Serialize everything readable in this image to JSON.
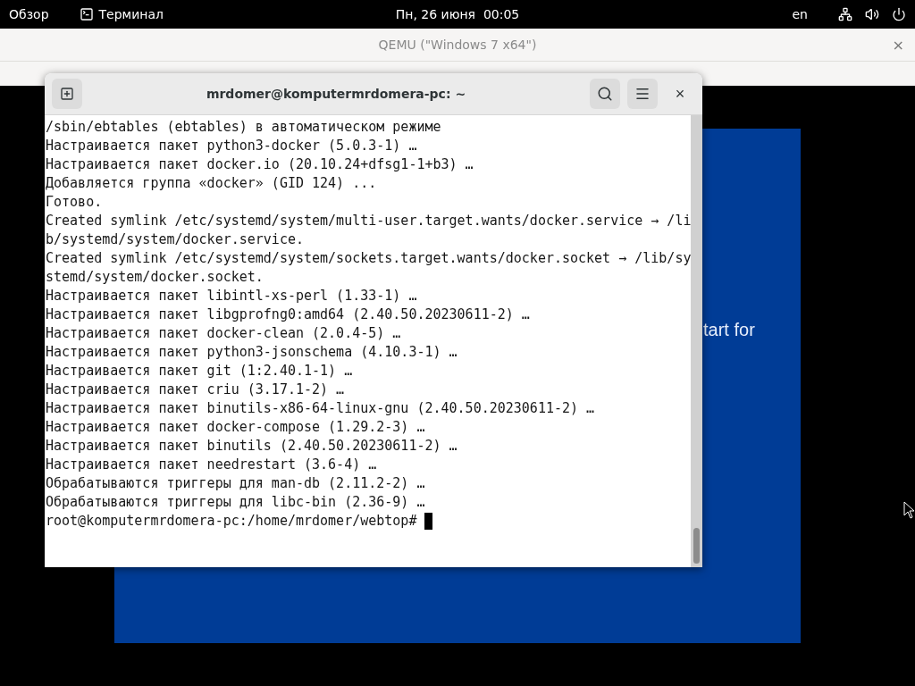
{
  "top_bar": {
    "activities": "Обзор",
    "app_menu": "Терминал",
    "clock": "Пн, 26 июня  00:05",
    "keyboard_layout": "en"
  },
  "qemu_window": {
    "title": "QEMU (\"Windows 7 x64\")",
    "close": "×",
    "guest_screen_text": "tart for"
  },
  "terminal": {
    "title": "mrdomer@komputermrdomera-pc: ~",
    "close": "×",
    "lines": [
      "/sbin/ebtables (ebtables) в автоматическом режиме",
      "Настраивается пакет python3-docker (5.0.3-1) …",
      "Настраивается пакет docker.io (20.10.24+dfsg1-1+b3) …",
      "Добавляется группа «docker» (GID 124) ...",
      "Готово.",
      "Created symlink /etc/systemd/system/multi-user.target.wants/docker.service → /li",
      "b/systemd/system/docker.service.",
      "Created symlink /etc/systemd/system/sockets.target.wants/docker.socket → /lib/sy",
      "stemd/system/docker.socket.",
      "Настраивается пакет libintl-xs-perl (1.33-1) …",
      "Настраивается пакет libgprofng0:amd64 (2.40.50.20230611-2) …",
      "Настраивается пакет docker-clean (2.0.4-5) …",
      "Настраивается пакет python3-jsonschema (4.10.3-1) …",
      "Настраивается пакет git (1:2.40.1-1) …",
      "Настраивается пакет criu (3.17.1-2) …",
      "Настраивается пакет binutils-x86-64-linux-gnu (2.40.50.20230611-2) …",
      "Настраивается пакет docker-compose (1.29.2-3) …",
      "Настраивается пакет binutils (2.40.50.20230611-2) …",
      "Настраивается пакет needrestart (3.6-4) …",
      "Обрабатываются триггеры для man-db (2.11.2-2) …",
      "Обрабатываются триггеры для libc-bin (2.36-9) …"
    ],
    "prompt": "root@komputermrdomera-pc:/home/mrdomer/webtop#"
  }
}
